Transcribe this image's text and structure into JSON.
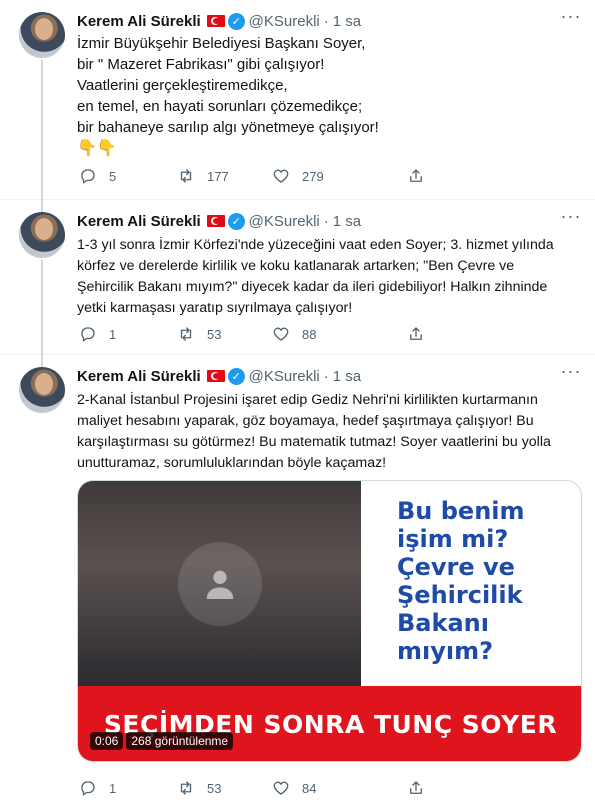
{
  "author": {
    "name": "Kerem Ali Sürekli",
    "handle": "@KSurekli",
    "separator": "·",
    "time": "1 sa"
  },
  "tweets": [
    {
      "lines": [
        "İzmir Büyükşehir Belediyesi Başkanı Soyer,",
        "bir \" Mazeret Fabrikası\" gibi çalışıyor!",
        "Vaatlerini gerçekleştiremedikçe,",
        "en temel, en hayati sorunları çözemedikçe;",
        "bir bahaneye sarılıp algı yönetmeye çalışıyor!"
      ],
      "emoji": "👇👇",
      "replies": "5",
      "retweets": "177",
      "likes": "279"
    },
    {
      "lines": [
        "1-3 yıl sonra İzmir Körfezi'nde yüzeceğini vaat eden Soyer; 3. hizmet yılında",
        "körfez ve derelerde kirlilik ve koku katlanarak artarken;  \"Ben Çevre ve",
        "Şehircilik Bakanı mıyım?\" diyecek kadar da ileri gidebiliyor! Halkın zihninde",
        "yetki karmaşası yaratıp sıyrılmaya çalışıyor!"
      ],
      "replies": "1",
      "retweets": "53",
      "likes": "88"
    },
    {
      "lines": [
        "2-Kanal İstanbul Projesini işaret edip Gediz Nehri'ni kirlilikten kurtarmanın",
        "maliyet hesabını yaparak, göz boyamaya, hedef şaşırtmaya çalışıyor! Bu",
        "karşılaştırması su götürmez! Bu matematik tutmaz! Soyer vaatlerini bu yolla",
        "unutturamaz, sorumluluklarından böyle kaçamaz!"
      ],
      "replies": "1",
      "retweets": "53",
      "likes": "84",
      "media": {
        "headline_lines": [
          "Bu benim",
          "işim mi?",
          "Çevre ve",
          "Şehircilik",
          "Bakanı",
          "mıyım?"
        ],
        "banner": "SEÇİMDEN SONRA TUNÇ SOYER",
        "duration": "0:06",
        "views": "268 görüntülenme"
      }
    }
  ],
  "icons": {
    "more": "more-icon",
    "reply": "reply-icon",
    "retweet": "retweet-icon",
    "like": "heart-icon",
    "share": "share-icon",
    "verified": "verified-badge-icon",
    "flag": "turkey-flag-icon"
  },
  "colors": {
    "verified": "#1d9bf0",
    "secondary_text": "#536471",
    "headline": "#1e4aa8",
    "banner": "#e0141d"
  }
}
